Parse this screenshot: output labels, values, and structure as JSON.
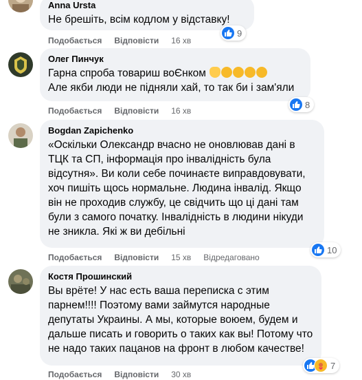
{
  "comments": [
    {
      "author": "Anna Ursta",
      "text": "Не брешіть, всім кодлом у відставку!",
      "like_label": "Подобається",
      "reply_label": "Відповісти",
      "time": "16 хв",
      "reactions": "9"
    },
    {
      "author": "Олег Пинчук",
      "text_line1": "Гарна спроба товариш воЄнком",
      "text_line2": "Але якби люди не підняли хай, то так би і зам'яли",
      "emoji": [
        "victory-hand",
        "laughing-face",
        "laughing-face",
        "laughing-face",
        "laughing-face"
      ],
      "like_label": "Подобається",
      "reply_label": "Відповісти",
      "time": "16 хв",
      "reactions": "8"
    },
    {
      "author": "Bogdan Zapichenko",
      "text": "«Оскільки Олександр вчасно не оновлював дані в ТЦК та СП, інформація про інвалідність була відсутня». Ви коли себе починаєте виправдовувати, хоч пишіть щось нормальне. Людина інвалід. Якщо він не проходив службу, це свідчить що ці дані там були з самого початку. Інвалідність в людини нікуди не зникла. Які ж ви дебільні",
      "like_label": "Подобається",
      "reply_label": "Відповісти",
      "time": "15 хв",
      "edited_label": "Відредаговано",
      "reactions": "10"
    },
    {
      "author": "Костя Прошинский",
      "text": "Вы врёте! У нас есть ваша переписка с этим парнем!!!! Поэтому вами займутся народные депутаты Украины. А мы, которые воюем, будем и дальше писать и говорить о таких как вы! Потому что не надо таких пацанов на фронт в любом качестве!",
      "like_label": "Подобається",
      "reply_label": "Відповісти",
      "time": "30 хв",
      "reactions": "7"
    }
  ],
  "colors": {
    "bubble": "#f0f2f5",
    "meta": "#65676b",
    "like": "#1877f2",
    "care": "#f7b928"
  }
}
